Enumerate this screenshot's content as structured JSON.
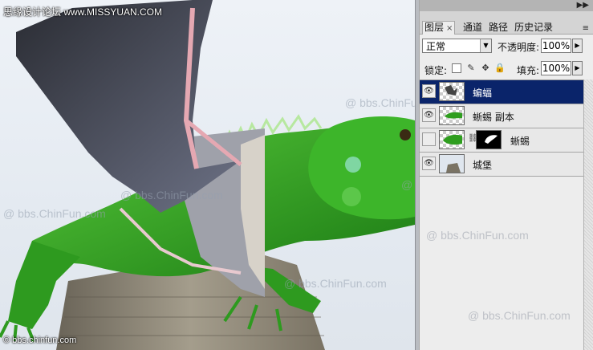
{
  "canvas": {
    "site_top": "思缘设计论坛 www.MISSYUAN.COM",
    "site_bottom": "© bbs.chinfun.com",
    "watermark": "@ bbs.ChinFun.com"
  },
  "panel": {
    "tabs": [
      {
        "label": "图层",
        "active": true,
        "close": "×"
      },
      {
        "label": "通道",
        "active": false
      },
      {
        "label": "路径",
        "active": false
      },
      {
        "label": "历史记录",
        "active": false
      }
    ],
    "collapse_icon": "double-chevron-right-icon",
    "menu_icon": "panel-menu-icon",
    "blend_mode": "正常",
    "opacity_label": "不透明度:",
    "opacity_value": "100%",
    "lock_label": "锁定:",
    "fill_label": "填充:",
    "fill_value": "100%",
    "lock_icons": [
      "lock-transparent-icon",
      "lock-image-icon",
      "lock-position-icon",
      "lock-all-icon"
    ],
    "layers": [
      {
        "name": "蝙蝠",
        "visible": true,
        "selected": true
      },
      {
        "name": "蜥蜴 副本",
        "visible": true,
        "selected": false
      },
      {
        "name": "蜥蜴",
        "visible": false,
        "selected": false,
        "has_mask": true
      },
      {
        "name": "城堡",
        "visible": true,
        "selected": false
      }
    ]
  },
  "colors": {
    "selected_layer": "#0a246a",
    "panel_bg": "#ededed",
    "lizard_green": "#2f9e1f"
  }
}
